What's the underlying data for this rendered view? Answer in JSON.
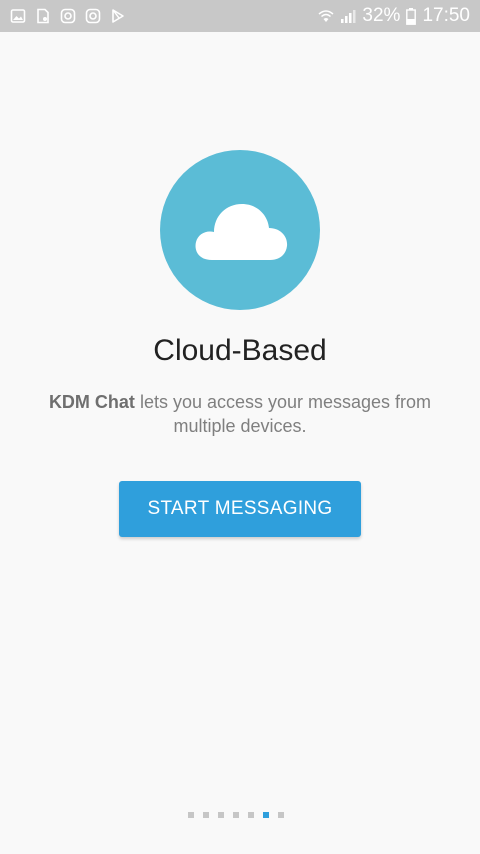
{
  "status_bar": {
    "battery": "32%",
    "time": "17:50",
    "left_icons": [
      "gallery-icon",
      "file-icon",
      "instagram-icon",
      "instagram-icon",
      "play-store-icon"
    ]
  },
  "onboarding": {
    "icon": "cloud-icon",
    "title": "Cloud-Based",
    "app_name": "KDM Chat",
    "desc_rest": " lets you access your messages from multiple devices.",
    "button_label": "START MESSAGING",
    "pages_total": 7,
    "active_page": 6
  },
  "colors": {
    "accent": "#2f9fdc",
    "circle": "#5bbcd6",
    "status_bar": "#c8c8c8",
    "background": "#f9f9f9"
  }
}
